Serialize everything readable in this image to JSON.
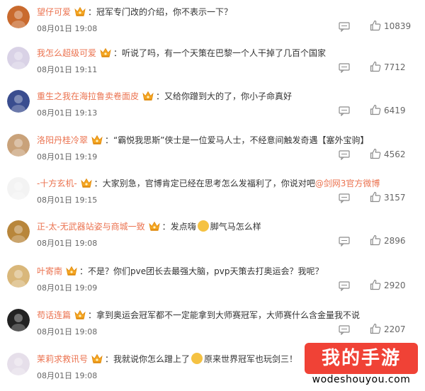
{
  "comments": [
    {
      "user": "望仔可爱",
      "sep": "：",
      "text": "冠军专门改的介绍，你不表示一下？",
      "time": "08月01日 19:08",
      "likes": "10839",
      "avatar_color": "#c96a2e"
    },
    {
      "user": "我怎么超级可爱",
      "sep": "：",
      "text": "听说了吗，有一个天策在巴黎一个人干掉了几百个国家",
      "time": "08月01日 19:11",
      "likes": "7712",
      "avatar_color": "#d9d2e6"
    },
    {
      "user": "重生之我在海拉鲁卖卷面皮",
      "sep": "：",
      "text": "又给你蹭到大的了，你小子命真好",
      "time": "08月01日 19:13",
      "likes": "6419",
      "avatar_color": "#3a4d8f"
    },
    {
      "user": "洛阳丹桂冷翠",
      "sep": "：",
      "text": "“霸悦我思斯”侠士是一位爱马人士，不经意间触发奇遇【塞外宝驹】",
      "time": "08月01日 19:19",
      "likes": "4562",
      "avatar_color": "#c9a27a"
    },
    {
      "user": "-十方玄机-",
      "sep": "：",
      "text": "大家别急，官博肯定已经在思考怎么发福利了，你说对吧",
      "mention": "@剑网3官方微博",
      "time": "08月01日 19:15",
      "likes": "3157",
      "avatar_color": "#f3f3f3"
    },
    {
      "user": "正-太-无武器站姿与商城一致",
      "sep": "：",
      "text": "发点嗨",
      "text2": "脚气马怎么样",
      "time": "08月01日 19:08",
      "likes": "2896",
      "avatar_color": "#b8863b"
    },
    {
      "user": "叶寄南",
      "sep": "：",
      "text": "不是？你们pve团长去最强大脑，pvp天策去打奥运会？我呢？",
      "time": "08月01日 19:09",
      "likes": "2920",
      "avatar_color": "#d9b77a"
    },
    {
      "user": "苟话连篇",
      "sep": "：",
      "text": "拿到奥运会冠军都不一定能拿到大师赛冠军，大师赛什么含金量我不说",
      "time": "08月01日 19:08",
      "likes": "2207",
      "avatar_color": "#222222"
    },
    {
      "user": "茉莉求救讯号",
      "sep": "：",
      "text": "我就说你怎么蹭上了",
      "text2": "原来世界冠军也玩剑三！",
      "time": "08月01日 19:08",
      "likes": "",
      "avatar_color": "#e6dfea"
    }
  ],
  "watermark": {
    "title": "我的手游",
    "url": "wodeshouyou.com"
  },
  "colors": {
    "username": "#eb7350",
    "watermark_bg": "#f04236"
  },
  "icons": {
    "crown": "crown-badge-icon",
    "reply": "comment-icon",
    "like": "thumbs-up-icon"
  }
}
